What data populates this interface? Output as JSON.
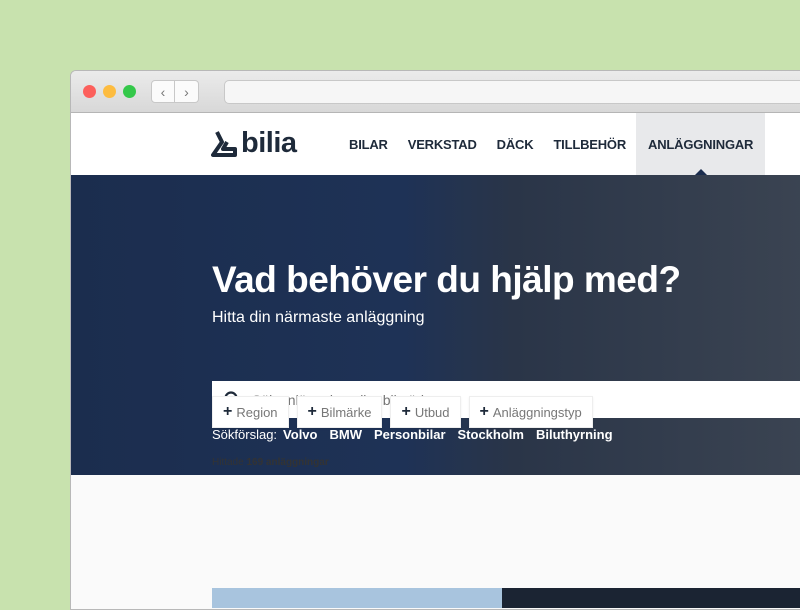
{
  "browser": {
    "url": ""
  },
  "logo": "bilia",
  "nav": [
    "BILAR",
    "VERKSTAD",
    "DÄCK",
    "TILLBEHÖR",
    "ANLÄGGNINGAR"
  ],
  "hero": {
    "title": "Vad behöver du hjälp med?",
    "subtitle": "Hitta din närmaste anläggning",
    "search_placeholder": "Sök anläggning eller bilmärke",
    "suggest_label": "Sökförslag:",
    "suggestions": [
      "Volvo",
      "BMW",
      "Personbilar",
      "Stockholm",
      "Biluthyrning"
    ]
  },
  "filters": [
    "Region",
    "Bilmärke",
    "Utbud",
    "Anläggningstyp"
  ],
  "results": {
    "prefix": "Hittade",
    "count": "169 anläggningar"
  }
}
